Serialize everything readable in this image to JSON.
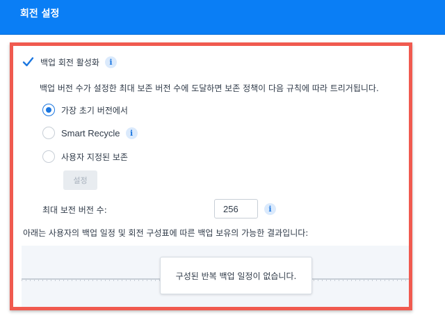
{
  "header": {
    "title": "회전 설정"
  },
  "enable_rotation": {
    "label": "백업 회전 활성화",
    "checked": true,
    "info_icon": "info-icon"
  },
  "description": "백업 버전 수가 설정한 최대 보존 버전 수에 도달하면 보존 정책이 다음 규칙에 따라 트리거됩니다.",
  "options": [
    {
      "label": "가장 초기 버전에서",
      "selected": true
    },
    {
      "label": "Smart Recycle",
      "selected": false,
      "info_icon": "info-icon"
    },
    {
      "label": "사용자 지정된 보존",
      "selected": false
    }
  ],
  "settings_button": {
    "label": "설정",
    "enabled": false
  },
  "max_versions": {
    "label": "최대 보전 버전 수:",
    "value": "256",
    "info_icon": "info-icon"
  },
  "result_description": "아래는 사용자의 백업 일정 및 회전 구성표에 따른 백업 보유의 가능한 결과입니다:",
  "preview": {
    "empty_message": "구성된 반복 백업 일정이 없습니다."
  },
  "colors": {
    "accent": "#1a76e0",
    "header": "#0a7ef5",
    "highlight_border": "#f05a4f"
  }
}
